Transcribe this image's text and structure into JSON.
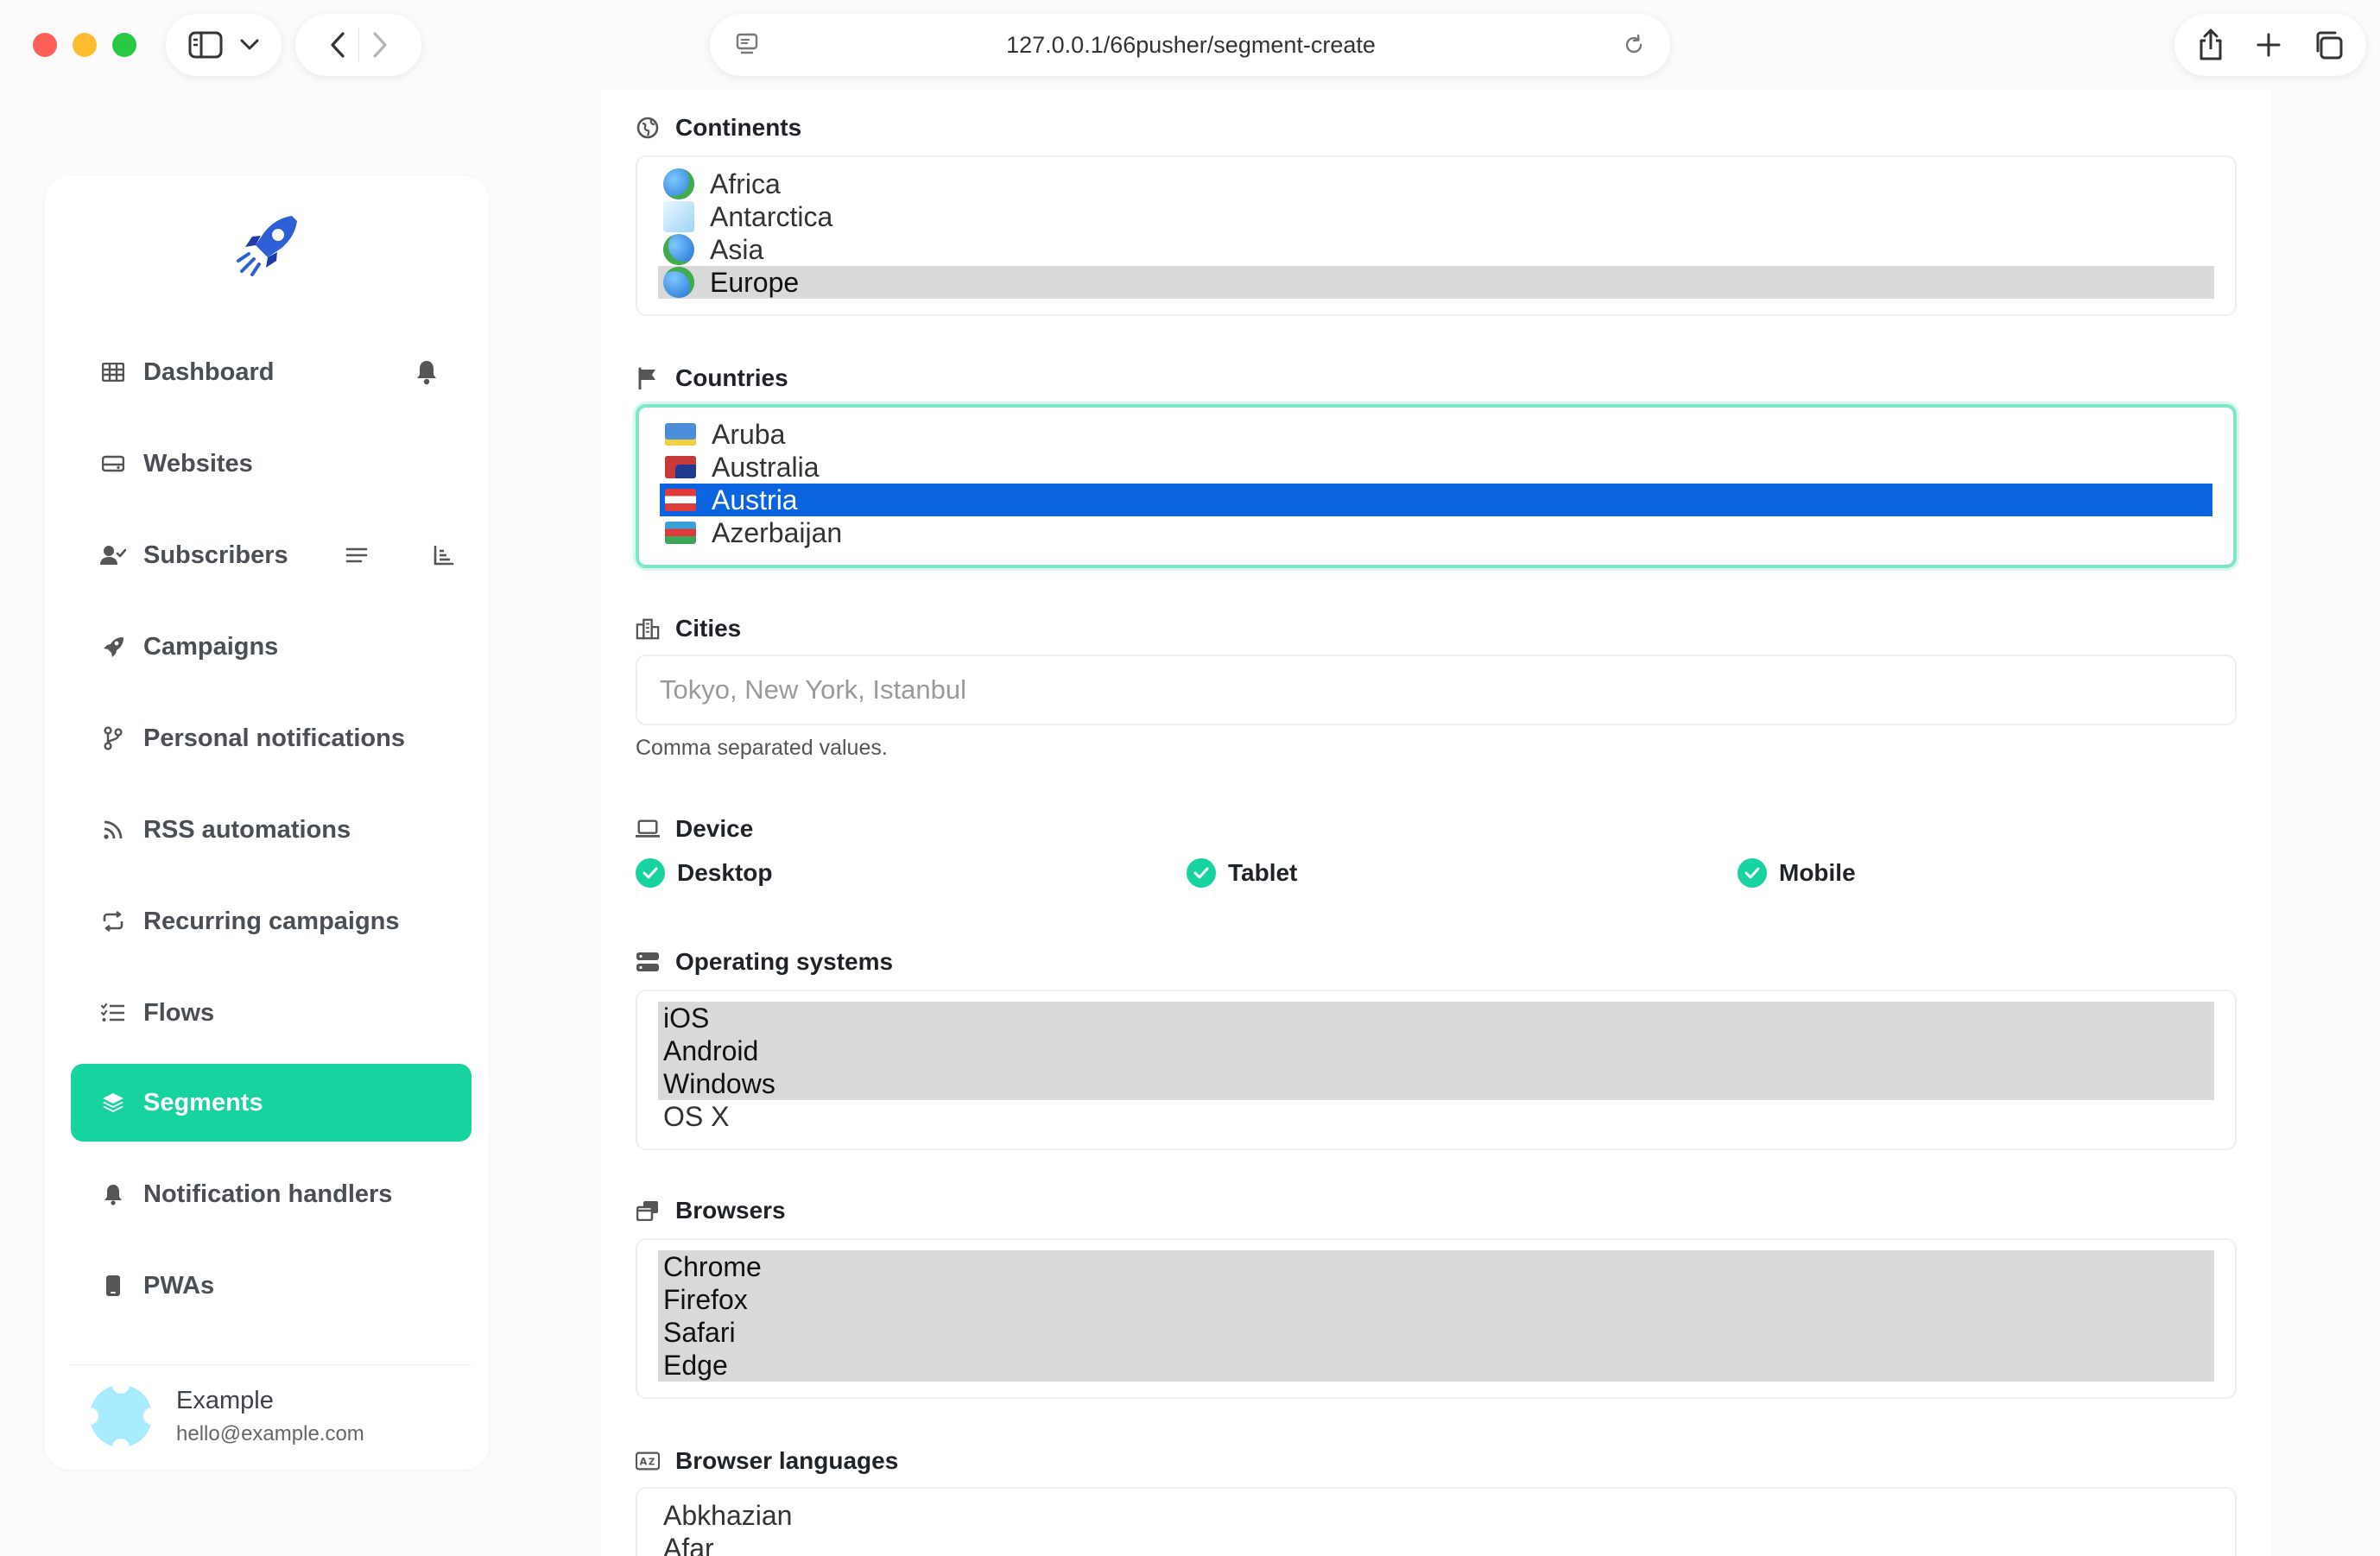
{
  "browser": {
    "url": "127.0.0.1/66pusher/segment-create"
  },
  "sidebar": {
    "items": [
      {
        "label": "Dashboard"
      },
      {
        "label": "Websites"
      },
      {
        "label": "Subscribers"
      },
      {
        "label": "Campaigns"
      },
      {
        "label": "Personal notifications"
      },
      {
        "label": "RSS automations"
      },
      {
        "label": "Recurring campaigns"
      },
      {
        "label": "Flows"
      },
      {
        "label": "Segments"
      },
      {
        "label": "Notification handlers"
      },
      {
        "label": "PWAs"
      }
    ],
    "active": "Segments",
    "user": {
      "name": "Example",
      "email": "hello@example.com"
    }
  },
  "form": {
    "continents": {
      "label": "Continents",
      "options": [
        "Africa",
        "Antarctica",
        "Asia",
        "Europe"
      ],
      "selected": [
        "Europe"
      ]
    },
    "countries": {
      "label": "Countries",
      "options": [
        "Aruba",
        "Australia",
        "Austria",
        "Azerbaijan"
      ],
      "selected": [
        "Austria"
      ]
    },
    "cities": {
      "label": "Cities",
      "placeholder": "Tokyo, New York, Istanbul",
      "help": "Comma separated values."
    },
    "device": {
      "label": "Device",
      "options": [
        {
          "label": "Desktop",
          "checked": true
        },
        {
          "label": "Tablet",
          "checked": true
        },
        {
          "label": "Mobile",
          "checked": true
        }
      ]
    },
    "operating_systems": {
      "label": "Operating systems",
      "options": [
        "iOS",
        "Android",
        "Windows",
        "OS X"
      ],
      "selected": [
        "iOS",
        "Android",
        "Windows"
      ]
    },
    "browsers": {
      "label": "Browsers",
      "options": [
        "Chrome",
        "Firefox",
        "Safari",
        "Edge"
      ],
      "selected": [
        "Chrome",
        "Firefox",
        "Safari",
        "Edge"
      ]
    },
    "browser_languages": {
      "label": "Browser languages",
      "options": [
        "Abkhazian",
        "Afar"
      ]
    }
  },
  "colors": {
    "accent": "#17d3a0",
    "selected_blue": "#0a63df",
    "selected_grey": "#d9d9d9"
  }
}
